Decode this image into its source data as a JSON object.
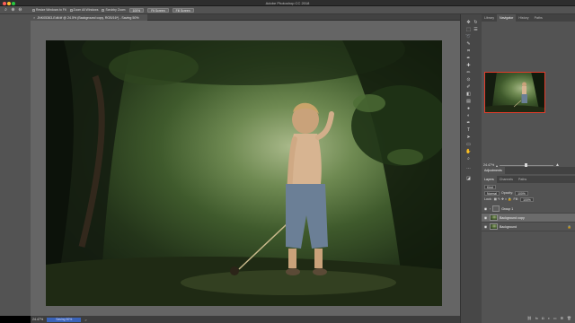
{
  "app": {
    "title": "Adobe Photoshop CC 2018"
  },
  "options_bar": {
    "checkboxes": [
      {
        "label": "Resize Windows to Fit"
      },
      {
        "label": "Zoom All Windows"
      },
      {
        "label": "Scrubby Zoom"
      }
    ],
    "buttons": [
      {
        "label": "100%"
      },
      {
        "label": "Fit Screen"
      },
      {
        "label": "Fill Screen"
      }
    ]
  },
  "document": {
    "tab_title": "JNK05363-Edit.tif @ 24.5% (Background copy, RGB/16*) - Saving 50%",
    "close_symbol": "×"
  },
  "status_bar": {
    "zoom": "24.47%",
    "timing": "Saving 50%",
    "arrow": ">"
  },
  "panels": {
    "top_tabs": [
      {
        "label": "Library"
      },
      {
        "label": "Navigator",
        "active": true
      },
      {
        "label": "History"
      },
      {
        "label": "Paths"
      }
    ],
    "navigator": {
      "zoom": "24.47%"
    },
    "adjustments_tabs": [
      {
        "label": "Adjustments",
        "active": true
      }
    ],
    "layers_tabs": [
      {
        "label": "Layers",
        "active": true
      },
      {
        "label": "Channels"
      },
      {
        "label": "Paths"
      }
    ],
    "layers": {
      "kind_label": "Kind",
      "blend_mode": "Normal",
      "opacity_label": "Opacity:",
      "opacity_value": "100%",
      "lock_label": "Lock:",
      "fill_label": "Fill:",
      "fill_value": "100%",
      "rows": [
        {
          "name": "Group 1",
          "type": "group",
          "selected": false
        },
        {
          "name": "Background copy",
          "type": "pixel",
          "selected": true
        },
        {
          "name": "Background",
          "type": "pixel",
          "selected": false,
          "locked": true
        }
      ],
      "lock_icon": "🔒"
    }
  },
  "icons": {
    "zoom_tool": "zoom-icon",
    "eye": "eye-icon",
    "lock": "lock-icon"
  }
}
